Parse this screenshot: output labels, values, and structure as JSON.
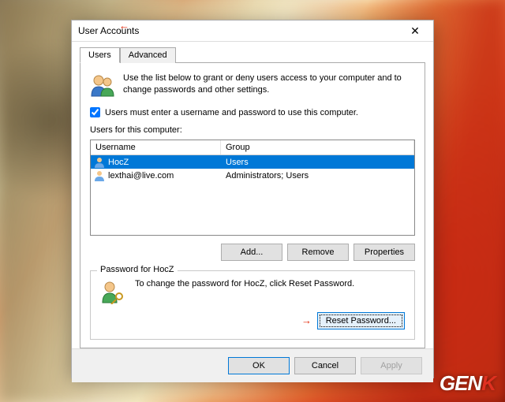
{
  "window": {
    "title": "User Accounts"
  },
  "tabs": {
    "users": "Users",
    "advanced": "Advanced"
  },
  "intro": "Use the list below to grant or deny users access to your computer and to change passwords and other settings.",
  "checkbox": {
    "label": "Users must enter a username and password to use this computer.",
    "checked": true
  },
  "list": {
    "label": "Users for this computer:",
    "cols": {
      "user": "Username",
      "group": "Group"
    },
    "rows": [
      {
        "user": "HocZ",
        "group": "Users",
        "selected": true
      },
      {
        "user": "lexthai@live.com",
        "group": "Administrators; Users",
        "selected": false
      }
    ]
  },
  "buttons": {
    "add": "Add...",
    "remove": "Remove",
    "properties": "Properties",
    "reset": "Reset Password...",
    "ok": "OK",
    "cancel": "Cancel",
    "apply": "Apply"
  },
  "password_group": {
    "legend": "Password for HocZ",
    "text": "To change the password for HocZ, click Reset Password."
  },
  "watermark": {
    "pre": "GEN",
    "k": "K"
  }
}
